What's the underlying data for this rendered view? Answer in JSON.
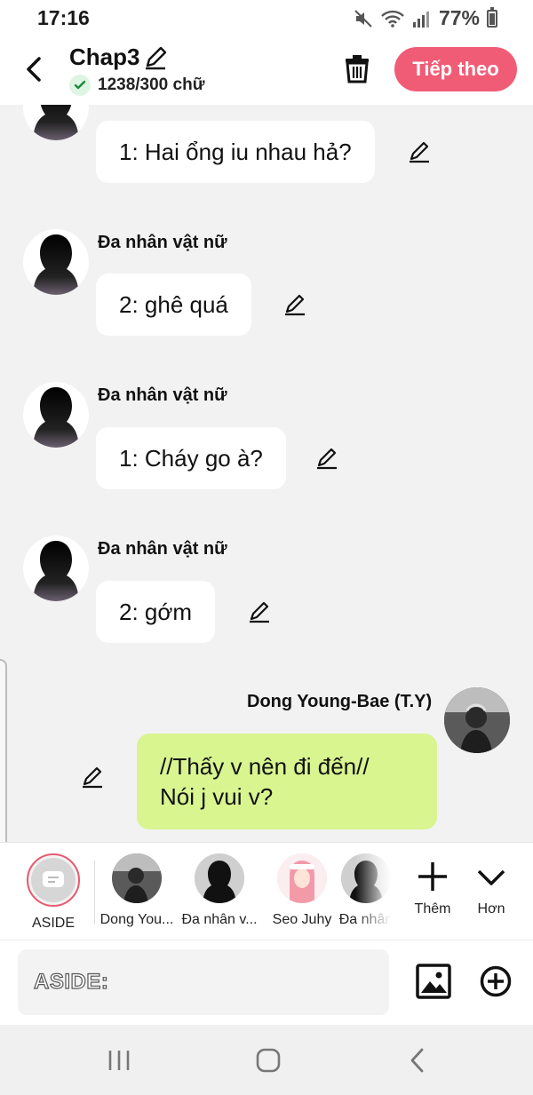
{
  "status_bar": {
    "time": "17:16",
    "battery": "77%"
  },
  "header": {
    "title": "Chap3",
    "word_count": "1238/300 chữ",
    "next_label": "Tiếp theo"
  },
  "messages": [
    {
      "side": "left",
      "sender": "",
      "text": "1: Hai ổng iu nhau hả?"
    },
    {
      "side": "left",
      "sender": "Đa nhân vật nữ",
      "text": "2: ghê quá"
    },
    {
      "side": "left",
      "sender": "Đa nhân vật nữ",
      "text": "1: Cháy go à?"
    },
    {
      "side": "left",
      "sender": "Đa nhân vật nữ",
      "text": "2: gớm"
    },
    {
      "side": "right",
      "sender": "Dong Young-Bae (T.Y)",
      "lines": [
        "//Thấy v nên đi đến//",
        "Nói j vui v?"
      ]
    }
  ],
  "characters": [
    {
      "label": "ASIDE",
      "icon": "aside-icon"
    },
    {
      "label": "Dong You...",
      "icon": "avatar-dong"
    },
    {
      "label": "Đa nhân v...",
      "icon": "avatar-silhouette"
    },
    {
      "label": "Seo Juhy",
      "icon": "avatar-seo"
    },
    {
      "label": "Đa nhân",
      "icon": "avatar-silhouette"
    }
  ],
  "tools": {
    "add_label": "Thêm",
    "more_label": "Hơn"
  },
  "input": {
    "prefix": "ASIDE:"
  },
  "colors": {
    "accent": "#f05c76",
    "own_bubble": "#d8f590",
    "background": "#f2f2f2"
  }
}
